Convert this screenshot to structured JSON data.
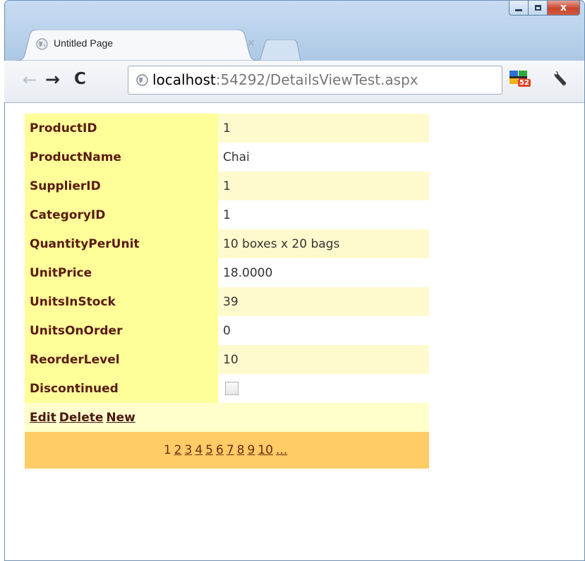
{
  "browser": {
    "tab_title": "Untitled Page",
    "tab_close": "×",
    "url_host": "localhost",
    "url_rest": ":54292/DetailsViewTest.aspx",
    "extension_badge": "52",
    "caption_close": "x"
  },
  "details": {
    "rows": [
      {
        "label": "ProductID",
        "value": "1"
      },
      {
        "label": "ProductName",
        "value": "Chai"
      },
      {
        "label": "SupplierID",
        "value": "1"
      },
      {
        "label": "CategoryID",
        "value": "1"
      },
      {
        "label": "QuantityPerUnit",
        "value": "10 boxes x 20 bags"
      },
      {
        "label": "UnitPrice",
        "value": "18.0000"
      },
      {
        "label": "UnitsInStock",
        "value": "39"
      },
      {
        "label": "UnitsOnOrder",
        "value": "0"
      },
      {
        "label": "ReorderLevel",
        "value": "10"
      },
      {
        "label": "Discontinued",
        "checked": false
      }
    ],
    "commands": [
      "Edit",
      "Delete",
      "New"
    ],
    "pager": {
      "current": "1",
      "links": [
        "2",
        "3",
        "4",
        "5",
        "6",
        "7",
        "8",
        "9",
        "10",
        "..."
      ]
    }
  },
  "colors": {
    "header_bg": "#ffff99",
    "alt_row_bg": "#fffacd",
    "command_bg": "#ffffcc",
    "pager_bg": "#ffcc66",
    "header_text": "#5a1b12"
  },
  "icons": {
    "back": "back-arrow-icon",
    "forward": "forward-arrow-icon",
    "reload": "reload-icon",
    "site": "globe-icon",
    "extension": "extension-icon",
    "menu": "wrench-icon"
  }
}
